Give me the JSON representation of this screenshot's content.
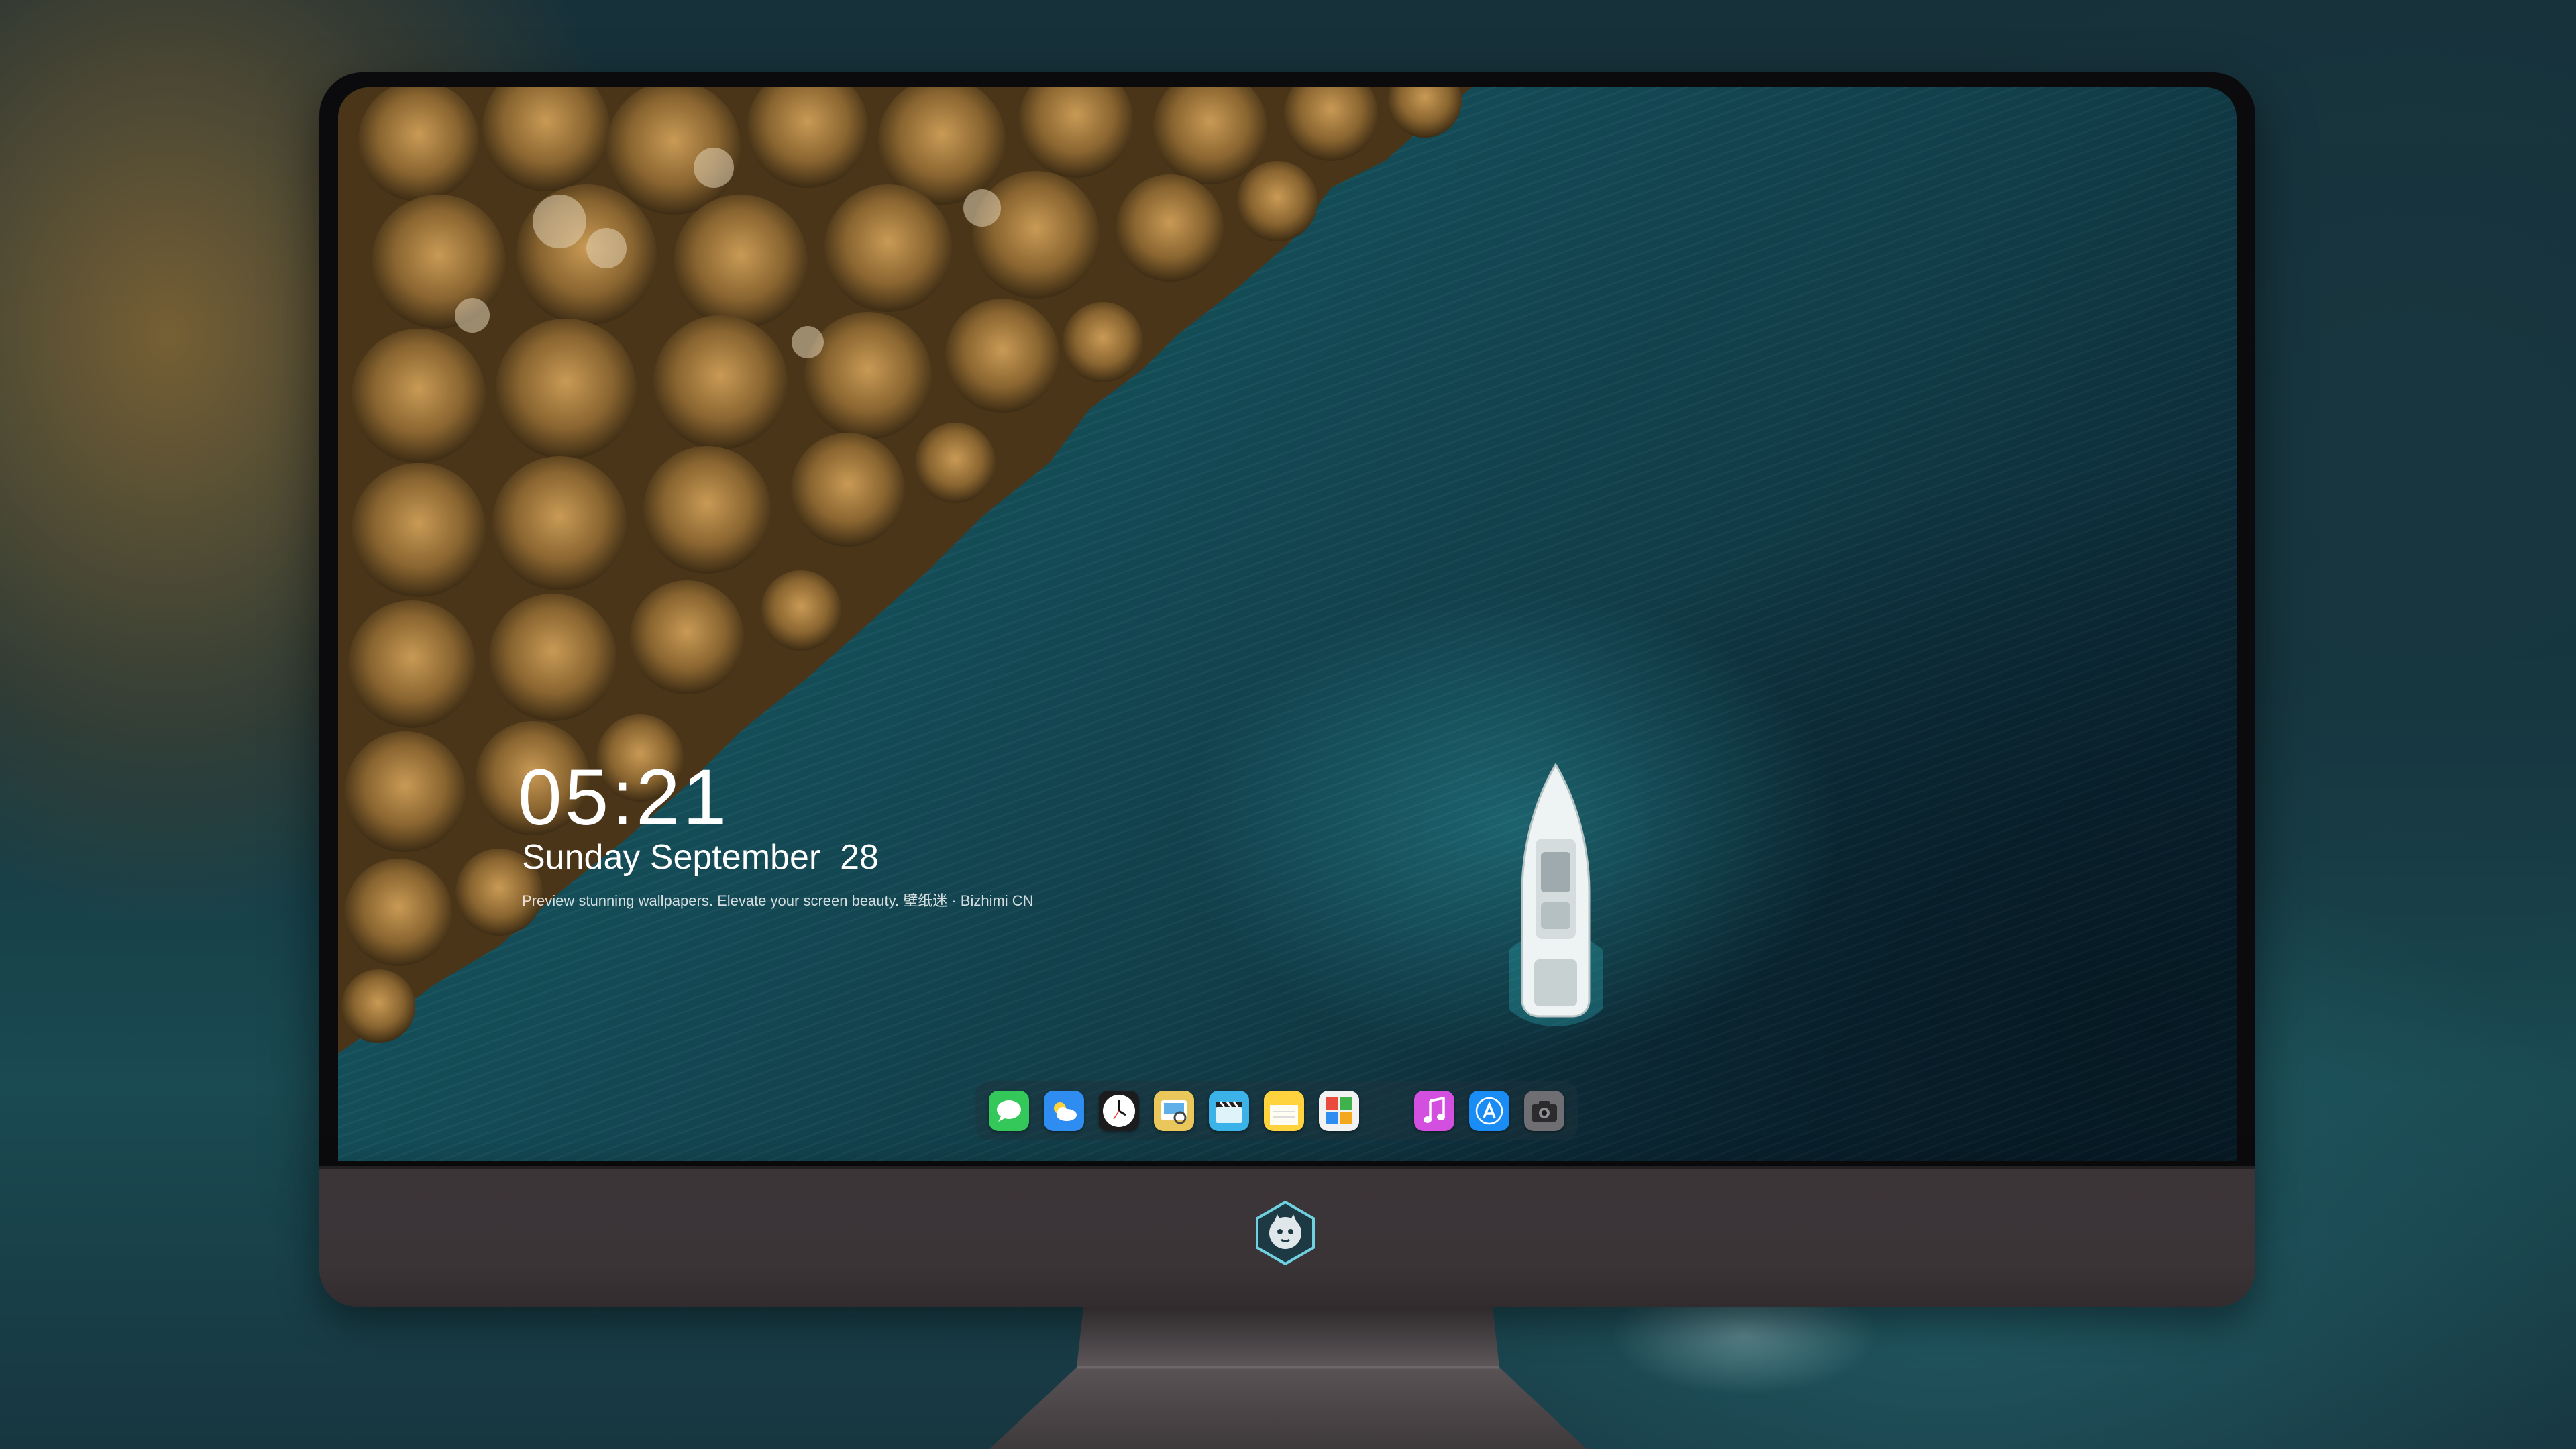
{
  "lockscreen": {
    "time": "05:21",
    "date": "Sunday September  28",
    "caption": "Preview stunning wallpapers. Elevate your screen beauty. 壁纸迷 · Bizhimi CN"
  },
  "dock": {
    "apps": [
      {
        "name": "Messages",
        "icon": "messages-icon",
        "color": "#34c759"
      },
      {
        "name": "Weather",
        "icon": "weather-icon",
        "color": "#2f8cf0"
      },
      {
        "name": "Clock",
        "icon": "clock-icon",
        "color": "#1c1c1e"
      },
      {
        "name": "Preview",
        "icon": "preview-icon",
        "color": "#e9c75a"
      },
      {
        "name": "Clips",
        "icon": "clapperboard-icon",
        "color": "#3bb3e8"
      },
      {
        "name": "Notes",
        "icon": "notes-icon",
        "color": "#ffd33d"
      },
      {
        "name": "Photo Booth",
        "icon": "photo-grid-icon",
        "color": "#e94c3d"
      },
      {
        "name": "iTunes",
        "icon": "music-icon",
        "color": "#d34fe0"
      },
      {
        "name": "App Store",
        "icon": "app-store-icon",
        "color": "#1a8cf5"
      },
      {
        "name": "Camera",
        "icon": "camera-icon",
        "color": "#6e6e73"
      }
    ]
  },
  "colors": {
    "water": "#15505b",
    "forest": "#8a6a30",
    "bezel": "#0b0b0d",
    "chin": "#3a3437",
    "stand": "#4a4548"
  }
}
